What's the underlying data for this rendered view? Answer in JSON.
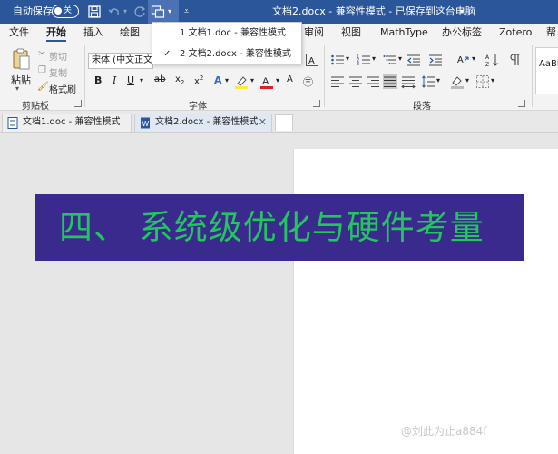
{
  "titlebar": {
    "autosave_label": "自动保存",
    "autosave_state": "关",
    "doc_title": "文档2.docx - 兼容性模式 - 已保存到这台电脑",
    "accent_color": "#2b579a"
  },
  "ribbon_tabs": [
    {
      "label": "文件"
    },
    {
      "label": "开始"
    },
    {
      "label": "插入"
    },
    {
      "label": "绘图"
    },
    {
      "label": "审阅"
    },
    {
      "label": "视图"
    },
    {
      "label": "MathType"
    },
    {
      "label": "办公标签"
    },
    {
      "label": "Zotero"
    },
    {
      "label": "帮"
    }
  ],
  "clipboard": {
    "paste_label": "粘贴",
    "cut_label": "剪切",
    "copy_label": "复制",
    "format_painter_label": "格式刷",
    "group_label": "剪贴板"
  },
  "font": {
    "font_name": "宋体 (中文正文)",
    "group_label": "字体"
  },
  "paragraph": {
    "group_label": "段落"
  },
  "styles": {
    "preview_label": "AaBb"
  },
  "window_dropdown": {
    "items": [
      {
        "label": "1 文档1.doc - 兼容性模式",
        "checked": false
      },
      {
        "label": "2 文档2.docx - 兼容性模式",
        "checked": true
      }
    ]
  },
  "doc_tabs": [
    {
      "label": "文档1.doc - 兼容性模式",
      "active": false
    },
    {
      "label": "文档2.docx - 兼容性模式",
      "active": true
    }
  ],
  "document": {
    "heading": "四、 系统级优化与硬件考量",
    "heading_bg": "#3a2a8e",
    "heading_color": "#22c55e"
  },
  "watermark": "@刘此为止a884f"
}
